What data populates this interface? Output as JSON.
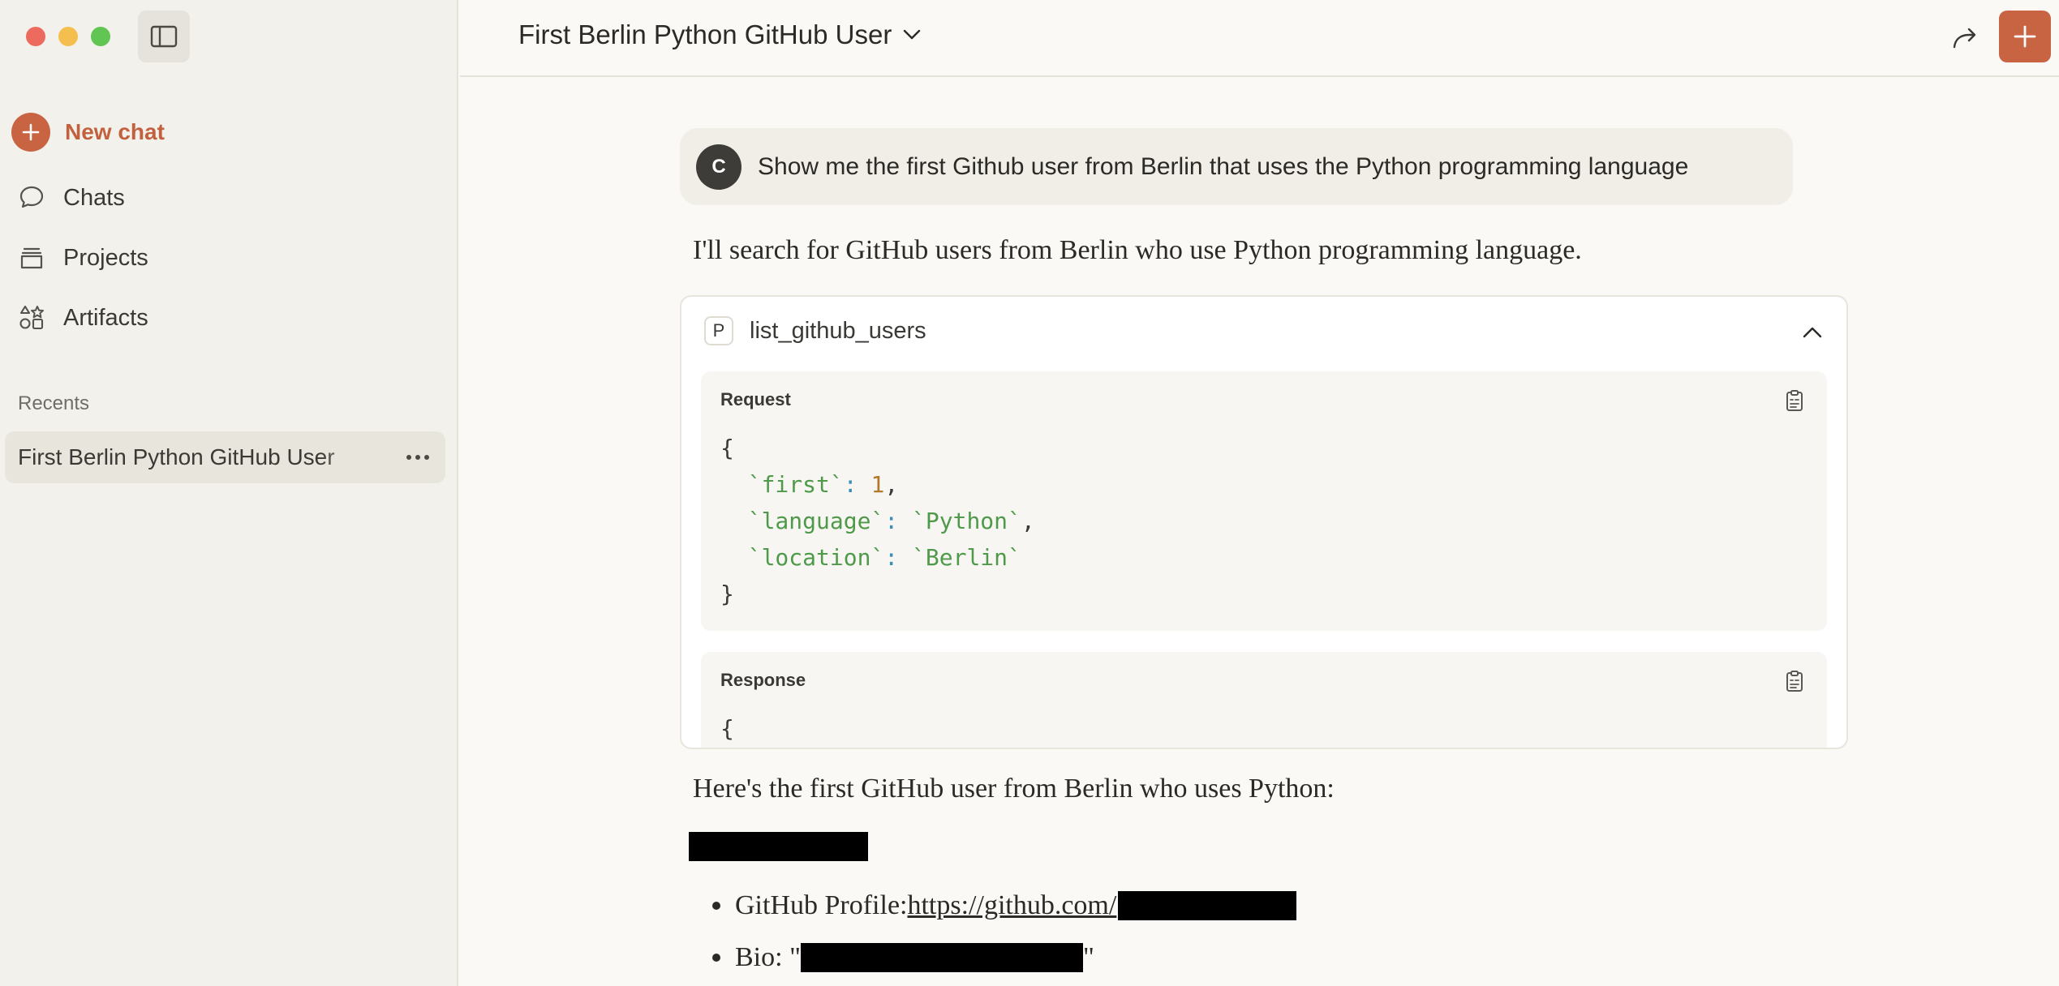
{
  "sidebar": {
    "new_chat_label": "New chat",
    "nav": [
      {
        "label": "Chats",
        "icon": "chat-bubble-icon"
      },
      {
        "label": "Projects",
        "icon": "folder-stack-icon"
      },
      {
        "label": "Artifacts",
        "icon": "shapes-icon"
      }
    ],
    "recents_label": "Recents",
    "recent_items": [
      {
        "label": "First Berlin Python GitHub User"
      }
    ]
  },
  "header": {
    "title": "First Berlin Python GitHub User"
  },
  "conversation": {
    "user": {
      "avatar_initial": "C",
      "message": "Show me the first Github user from Berlin that uses the Python programming language"
    },
    "assistant_intro": "I'll search for GitHub users from Berlin who use Python programming language.",
    "tool_call": {
      "badge": "P",
      "name": "list_github_users",
      "request_label": "Request",
      "response_label": "Response",
      "request_body": {
        "open": "{",
        "first_key": "`first`",
        "first_value": "1",
        "language_key": "`language`",
        "language_value": "`Python`",
        "location_key": "`location`",
        "location_value": "`Berlin`",
        "close": "}"
      },
      "response_preview": "{"
    },
    "assistant_result": "Here's the first GitHub user from Berlin who uses Python:",
    "bullets": {
      "profile_label": "GitHub Profile: ",
      "profile_link": "https://github.com/",
      "bio_label": "Bio: \"",
      "bio_close": "\""
    }
  },
  "colors": {
    "accent": "#c96442",
    "sidebar_bg": "#f3f1eb",
    "main_bg": "#faf9f5"
  }
}
